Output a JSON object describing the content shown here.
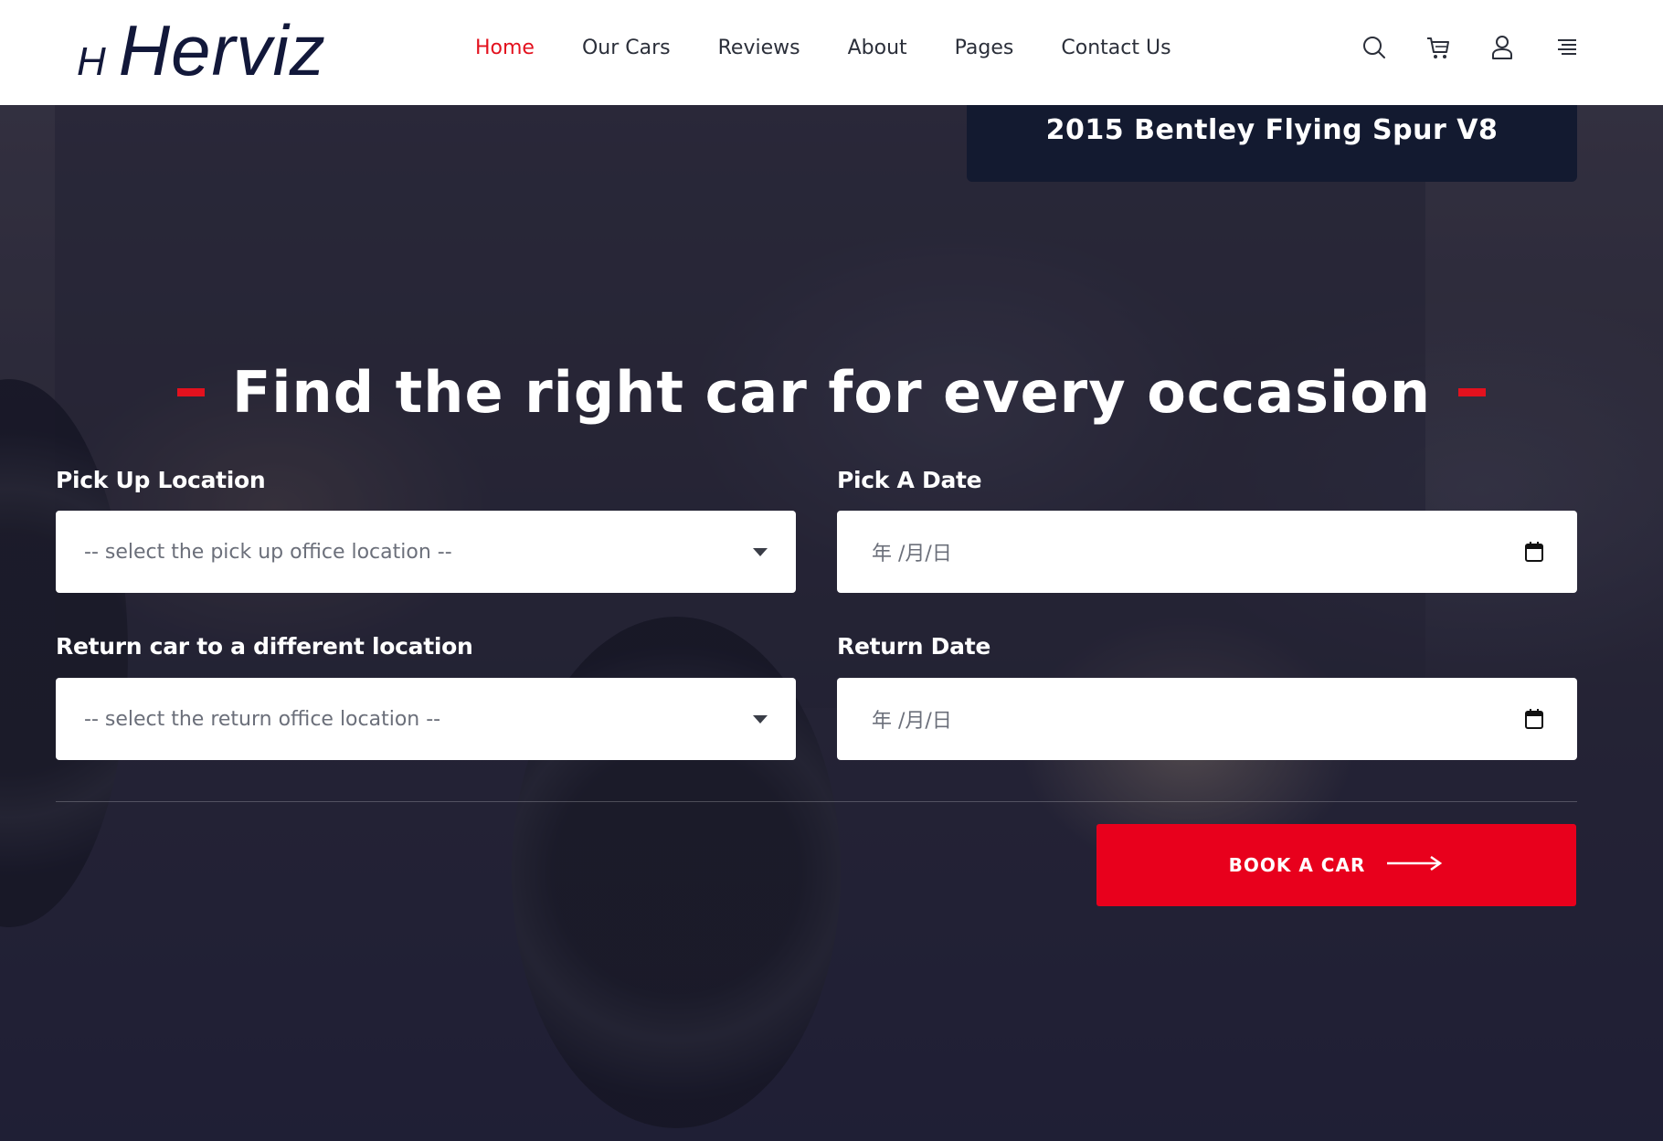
{
  "brand": {
    "mark": "H",
    "name": "Herviz"
  },
  "nav": {
    "items": [
      {
        "label": "Home",
        "active": true
      },
      {
        "label": "Our Cars"
      },
      {
        "label": "Reviews"
      },
      {
        "label": "About"
      },
      {
        "label": "Pages"
      },
      {
        "label": "Contact Us"
      }
    ]
  },
  "header_icons": [
    "search-icon",
    "cart-icon",
    "user-icon",
    "menu-icon"
  ],
  "featured": {
    "title": "2015 Bentley Flying Spur V8"
  },
  "hero": {
    "title": "Find the right car for every occasion"
  },
  "form": {
    "pickup_location": {
      "label": "Pick Up Location",
      "placeholder": "-- select the pick up office location --"
    },
    "pickup_date": {
      "label": "Pick A Date",
      "placeholder": "年 /月/日"
    },
    "return_location": {
      "label": "Return car to a different location",
      "placeholder": "-- select the return office location --"
    },
    "return_date": {
      "label": "Return Date",
      "placeholder": "年 /月/日"
    },
    "submit_label": "BOOK A CAR"
  },
  "colors": {
    "accent": "#e8001c",
    "nav_active": "#e3111e",
    "brand": "#12183a"
  }
}
